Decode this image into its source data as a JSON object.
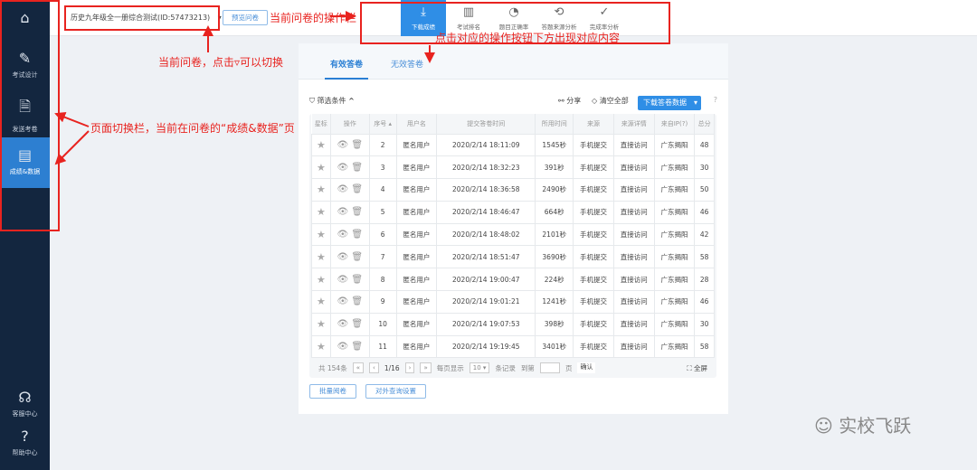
{
  "sidebar": {
    "items": [
      {
        "label": "考试设计"
      },
      {
        "label": "发送考卷"
      },
      {
        "label": "成绩&数据"
      }
    ],
    "bottom": [
      {
        "label": "客服中心"
      },
      {
        "label": "帮助中心"
      }
    ]
  },
  "header": {
    "survey_select": "历史九年级全一册综合测试(ID:57473213)",
    "preview_label": "预览问卷",
    "ops": [
      {
        "label": "下载成绩",
        "icon": "⤓"
      },
      {
        "label": "考试排名",
        "icon": "▥"
      },
      {
        "label": "题目正确率",
        "icon": "◔"
      },
      {
        "label": "答题来源分析",
        "icon": "⟲"
      },
      {
        "label": "完成率分析",
        "icon": "✓"
      }
    ]
  },
  "tabs": {
    "valid": "有效答卷",
    "invalid": "无效答卷"
  },
  "toolbar": {
    "filter": "筛选条件",
    "share": "分享",
    "clear": "清空全部",
    "download": "下载答卷数据"
  },
  "table": {
    "headers": [
      "星标",
      "操作",
      "序号 ▴",
      "用户名",
      "提交答卷时间",
      "所用时间",
      "来源",
      "来源详情",
      "来自IP(?)",
      "总分"
    ],
    "rows": [
      [
        "2",
        "匿名用户",
        "2020/2/14 18:11:09",
        "1545秒",
        "手机提交",
        "直接访问",
        "广东揭阳",
        "48"
      ],
      [
        "3",
        "匿名用户",
        "2020/2/14 18:32:23",
        "391秒",
        "手机提交",
        "直接访问",
        "广东揭阳",
        "30"
      ],
      [
        "4",
        "匿名用户",
        "2020/2/14 18:36:58",
        "2490秒",
        "手机提交",
        "直接访问",
        "广东揭阳",
        "50"
      ],
      [
        "5",
        "匿名用户",
        "2020/2/14 18:46:47",
        "664秒",
        "手机提交",
        "直接访问",
        "广东揭阳",
        "46"
      ],
      [
        "6",
        "匿名用户",
        "2020/2/14 18:48:02",
        "2101秒",
        "手机提交",
        "直接访问",
        "广东揭阳",
        "42"
      ],
      [
        "7",
        "匿名用户",
        "2020/2/14 18:51:47",
        "3690秒",
        "手机提交",
        "直接访问",
        "广东揭阳",
        "58"
      ],
      [
        "8",
        "匿名用户",
        "2020/2/14 19:00:47",
        "224秒",
        "手机提交",
        "直接访问",
        "广东揭阳",
        "28"
      ],
      [
        "9",
        "匿名用户",
        "2020/2/14 19:01:21",
        "1241秒",
        "手机提交",
        "直接访问",
        "广东揭阳",
        "46"
      ],
      [
        "10",
        "匿名用户",
        "2020/2/14 19:07:53",
        "398秒",
        "手机提交",
        "直接访问",
        "广东揭阳",
        "30"
      ],
      [
        "11",
        "匿名用户",
        "2020/2/14 19:19:45",
        "3401秒",
        "手机提交",
        "直接访问",
        "广东揭阳",
        "58"
      ]
    ]
  },
  "pagination": {
    "total": "共 154条",
    "page": "1/16",
    "per_page_label": "每页显示",
    "per_page": "10",
    "records": "条记录",
    "goto": "到第",
    "page_unit": "页",
    "confirm": "确认",
    "fullscreen": "全屏"
  },
  "actions": {
    "batch": "批量阅卷",
    "external": "对外查询设置"
  },
  "annotations": {
    "ops_bar": "当前问卷的操作栏",
    "ops_hint": "点击对应的操作按钮下方出现对应内容",
    "switch": "当前问卷，点击▿可以切换",
    "page_switch": "页面切换栏，当前在问卷的“成绩&数据”页"
  },
  "watermark": "实校飞跃"
}
